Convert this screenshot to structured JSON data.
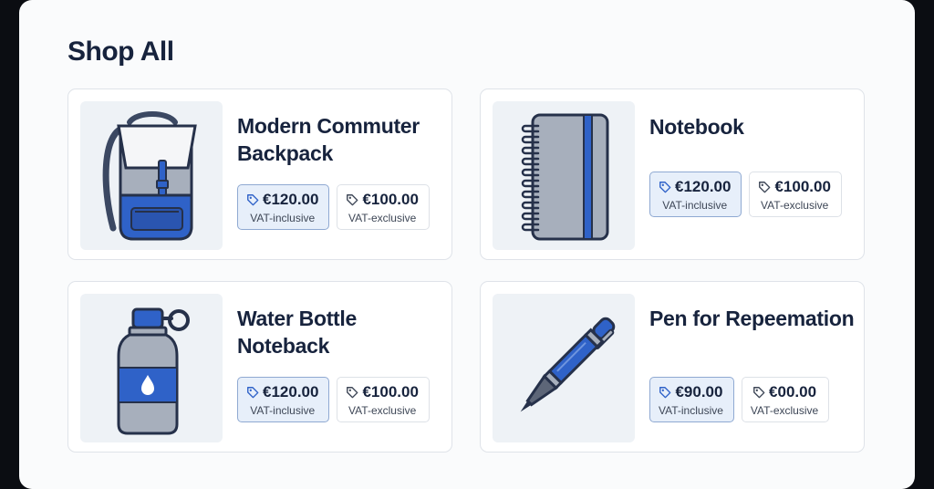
{
  "page": {
    "title": "Shop All"
  },
  "products": [
    {
      "name": "Modern Commuter Backpack",
      "icon": "backpack-icon",
      "prices": [
        {
          "amount": "€120.00",
          "label": "VAT-inclusive",
          "selected": true
        },
        {
          "amount": "€100.00",
          "label": "VAT-exclusive",
          "selected": false
        }
      ]
    },
    {
      "name": "Notebook",
      "icon": "notebook-icon",
      "prices": [
        {
          "amount": "€120.00",
          "label": "VAT-inclusive",
          "selected": true
        },
        {
          "amount": "€100.00",
          "label": "VAT-exclusive",
          "selected": false
        }
      ]
    },
    {
      "name": "Water Bottle Noteback",
      "icon": "water-bottle-icon",
      "prices": [
        {
          "amount": "€120.00",
          "label": "VAT-inclusive",
          "selected": true
        },
        {
          "amount": "€100.00",
          "label": "VAT-exclusive",
          "selected": false
        }
      ]
    },
    {
      "name": "Pen for Repeemation",
      "icon": "pen-icon",
      "prices": [
        {
          "amount": "€90.00",
          "label": "VAT-inclusive",
          "selected": true
        },
        {
          "amount": "€00.00",
          "label": "VAT-exclusive",
          "selected": false
        }
      ]
    }
  ],
  "colors": {
    "accent": "#2f62c8",
    "selected_bg": "#e7effa",
    "title": "#17233d",
    "thumb_bg": "#eef2f6"
  }
}
